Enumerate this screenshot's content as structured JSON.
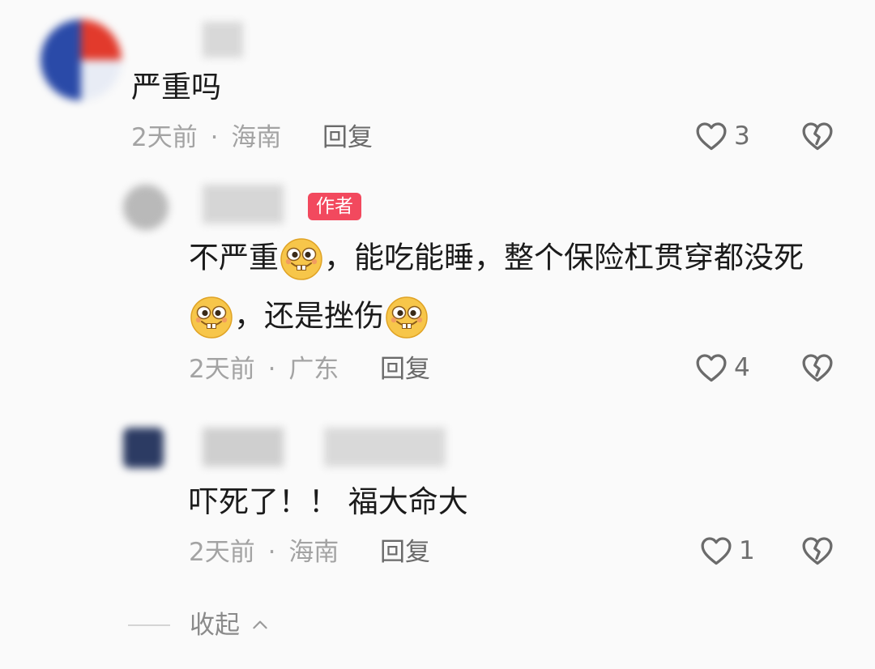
{
  "comments": [
    {
      "text": "严重吗",
      "time": "2天前",
      "sep": "·",
      "location": "海南",
      "reply_label": "回复",
      "likes": "3"
    },
    {
      "author_badge": "作者",
      "text_part1": "不严重",
      "text_part2": "，能吃能睡，整个保险杠贯穿都没死",
      "text_part3": "，还是挫伤",
      "time": "2天前",
      "sep": "·",
      "location": "广东",
      "reply_label": "回复",
      "likes": "4"
    },
    {
      "text": "吓死了！！ 福大命大",
      "time": "2天前",
      "sep": "·",
      "location": "海南",
      "reply_label": "回复",
      "likes": "1"
    }
  ],
  "collapse_label": "收起",
  "icons": {
    "like": "heart-outline-icon",
    "dislike": "broken-heart-icon",
    "emoji": "grinning-face-emoji",
    "collapse": "chevron-up-icon"
  },
  "colors": {
    "badge": "#f2495e",
    "meta": "#a3a3a3",
    "text": "#1b1b1b"
  }
}
